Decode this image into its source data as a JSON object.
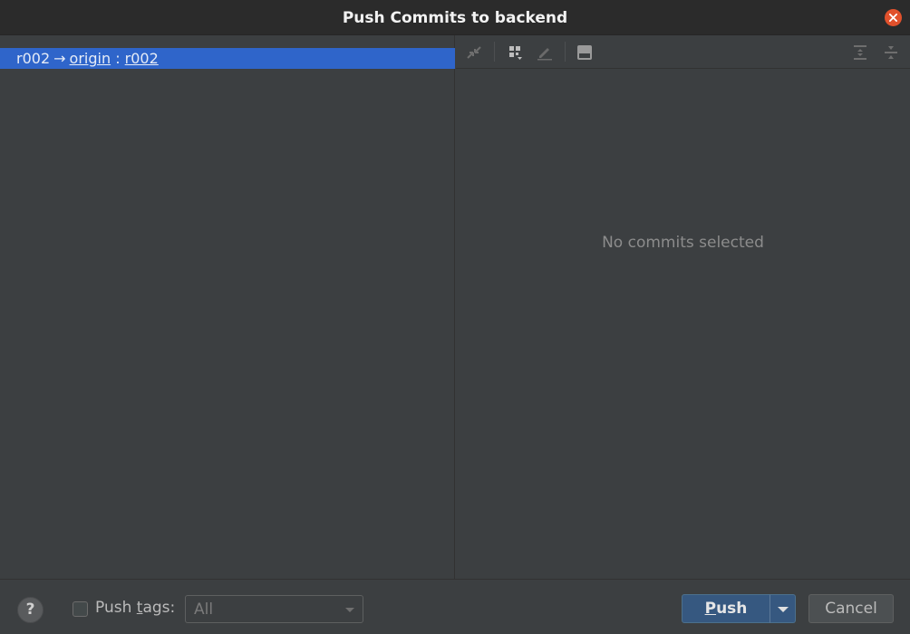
{
  "window": {
    "title": "Push Commits to backend"
  },
  "repo_row": {
    "local_branch": "r002",
    "arrow": "→",
    "remote": "origin",
    "separator": ":",
    "remote_branch": "r002"
  },
  "details": {
    "empty_message": "No commits selected"
  },
  "toolbar": {
    "icons": [
      "arrows-merge-icon",
      "group-by-icon",
      "edit-icon",
      "preview-panel-icon",
      "expand-all-icon",
      "collapse-all-icon"
    ]
  },
  "footer": {
    "help_label": "?",
    "push_tags_prefix": "Push ",
    "push_tags_mnemonic": "t",
    "push_tags_suffix": "ags:",
    "push_tags_checked": false,
    "tags_select_value": "All",
    "push_mnemonic": "P",
    "push_rest": "ush",
    "cancel_label": "Cancel"
  },
  "colors": {
    "selection": "#2f65ca",
    "close_button": "#e1512c",
    "primary_button": "#365880",
    "background": "#3c3f41"
  }
}
